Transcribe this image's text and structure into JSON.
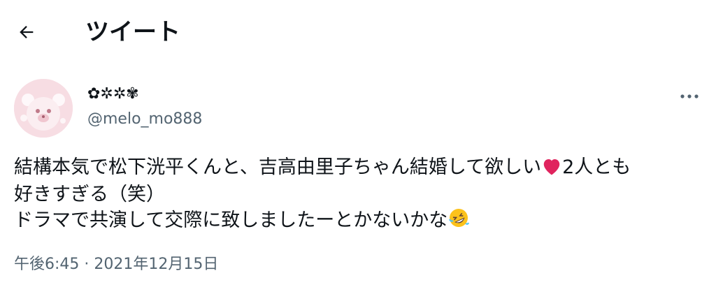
{
  "header": {
    "title": "ツイート",
    "back_icon": "arrow-left-icon"
  },
  "author": {
    "display_name": "✿✲✲✾",
    "handle": "@melo_mo888",
    "avatar_icon": "bear-avatar"
  },
  "more_icon": "more-horizontal-icon",
  "tweet": {
    "line1_before_icon": "結構本気で松下洸平くんと、吉高由里子ちゃん結婚して欲しい",
    "line1_icon": "red-heart-emoji",
    "line1_after_icon": "2人とも",
    "line2": "好きすぎる（笑）",
    "line3_before_icon": "ドラマで共演して交際に致しましたーとかないかな",
    "line3_icon": "rolling-on-floor-laughing-emoji"
  },
  "meta": {
    "time": "午後6:45",
    "separator": " · ",
    "date": "2021年12月15日"
  },
  "colors": {
    "text": "#0f1419",
    "secondary": "#536471",
    "heart": "#e0245e",
    "avatar_bg": "#f7dde3"
  }
}
